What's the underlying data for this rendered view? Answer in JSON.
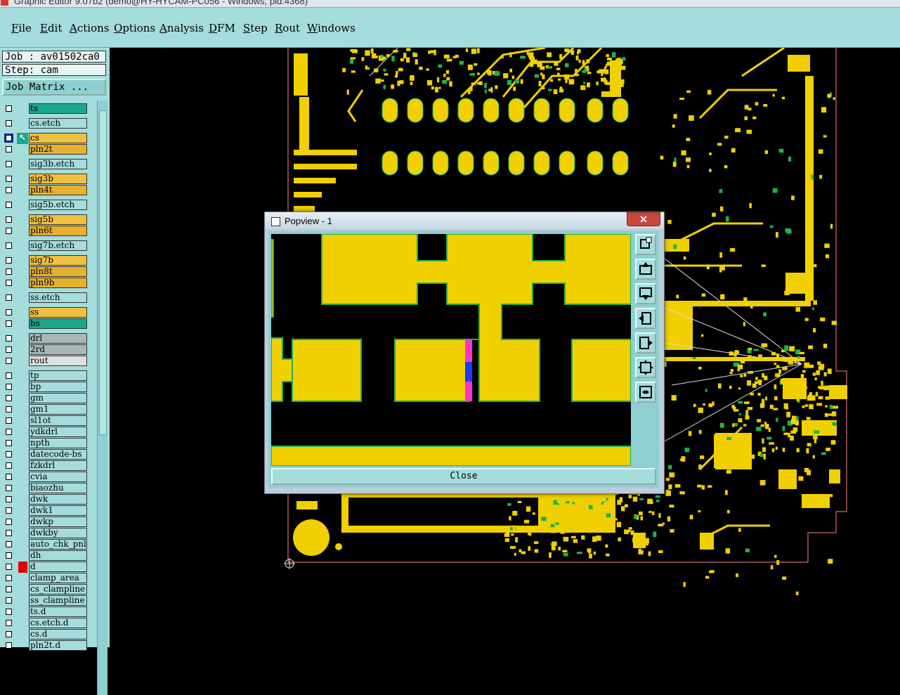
{
  "window": {
    "title": "Graphic Editor 9.07b2 (demo@HY-HYCAM-PC056 - Windows, pid:4368)"
  },
  "menu": [
    "File",
    "Edit",
    "Actions",
    "Options",
    "Analysis",
    "DFM",
    "Step",
    "Rout",
    "Windows"
  ],
  "job": {
    "label": "Job : av01502ca0",
    "step": "Step: cam",
    "matrix_button": "Job Matrix ..."
  },
  "layers": [
    {
      "name": "ts",
      "color": "#1aa88a"
    },
    {
      "name": "cs.etch",
      "color": "#a5dcdc"
    },
    {
      "name": "cs",
      "color": "#f0c040",
      "active": true
    },
    {
      "name": "pln2t",
      "color": "#e6b030"
    },
    {
      "name": "sig3b.etch",
      "color": "#a5dcdc"
    },
    {
      "name": "sig3b",
      "color": "#f0c040"
    },
    {
      "name": "pln4t",
      "color": "#e6b030"
    },
    {
      "name": "sig5b.etch",
      "color": "#a5dcdc"
    },
    {
      "name": "sig5b",
      "color": "#f0c040"
    },
    {
      "name": "pln6t",
      "color": "#e6b030"
    },
    {
      "name": "sig7b.etch",
      "color": "#a5dcdc"
    },
    {
      "name": "sig7b",
      "color": "#f0c040"
    },
    {
      "name": "pln8t",
      "color": "#e6b030"
    },
    {
      "name": "pln9b",
      "color": "#e6b030"
    },
    {
      "name": "ss.etch",
      "color": "#a5dcdc"
    },
    {
      "name": "ss",
      "color": "#f0c040"
    },
    {
      "name": "bs",
      "color": "#1aa88a"
    },
    {
      "name": "drl",
      "color": "#a8b8b8"
    },
    {
      "name": "2rd",
      "color": "#a8b8b8"
    },
    {
      "name": "rout",
      "color": "#dde0e0"
    },
    {
      "name": "tp",
      "color": "#a5dcdc"
    },
    {
      "name": "bp",
      "color": "#a5dcdc"
    },
    {
      "name": "gm",
      "color": "#a5dcdc"
    },
    {
      "name": "gm1",
      "color": "#a5dcdc"
    },
    {
      "name": "sl1ot",
      "color": "#a5dcdc"
    },
    {
      "name": "ydkdrl",
      "color": "#a5dcdc"
    },
    {
      "name": "npth",
      "color": "#a5dcdc"
    },
    {
      "name": "datecode-bs",
      "color": "#a5dcdc"
    },
    {
      "name": "fzkdrl",
      "color": "#a5dcdc"
    },
    {
      "name": "cvia",
      "color": "#a5dcdc"
    },
    {
      "name": "biaozhu",
      "color": "#a5dcdc"
    },
    {
      "name": "dwk",
      "color": "#a5dcdc"
    },
    {
      "name": "dwk1",
      "color": "#a5dcdc"
    },
    {
      "name": "dwkp",
      "color": "#a5dcdc"
    },
    {
      "name": "dwkby",
      "color": "#a5dcdc"
    },
    {
      "name": "auto_chk_pnl",
      "color": "#a5dcdc"
    },
    {
      "name": "dh",
      "color": "#a5dcdc"
    },
    {
      "name": "d",
      "color": "#a5dcdc",
      "marker": "#e00000"
    },
    {
      "name": "clamp_area",
      "color": "#a5dcdc"
    },
    {
      "name": "cs_clampline",
      "color": "#a5dcdc"
    },
    {
      "name": "ss_clampline",
      "color": "#a5dcdc"
    },
    {
      "name": "ts.d",
      "color": "#a5dcdc"
    },
    {
      "name": "cs.etch.d",
      "color": "#a5dcdc"
    },
    {
      "name": "cs.d",
      "color": "#a5dcdc"
    },
    {
      "name": "pln2t.d",
      "color": "#a5dcdc"
    }
  ],
  "popview": {
    "title": "Popview - 1",
    "close_x": "✕",
    "close_label": "Close"
  },
  "colors": {
    "copper": "#f0d000",
    "outline": "#1fb24a",
    "highlight_pink": "#ff33cc",
    "highlight_blue": "#1a3cff"
  }
}
